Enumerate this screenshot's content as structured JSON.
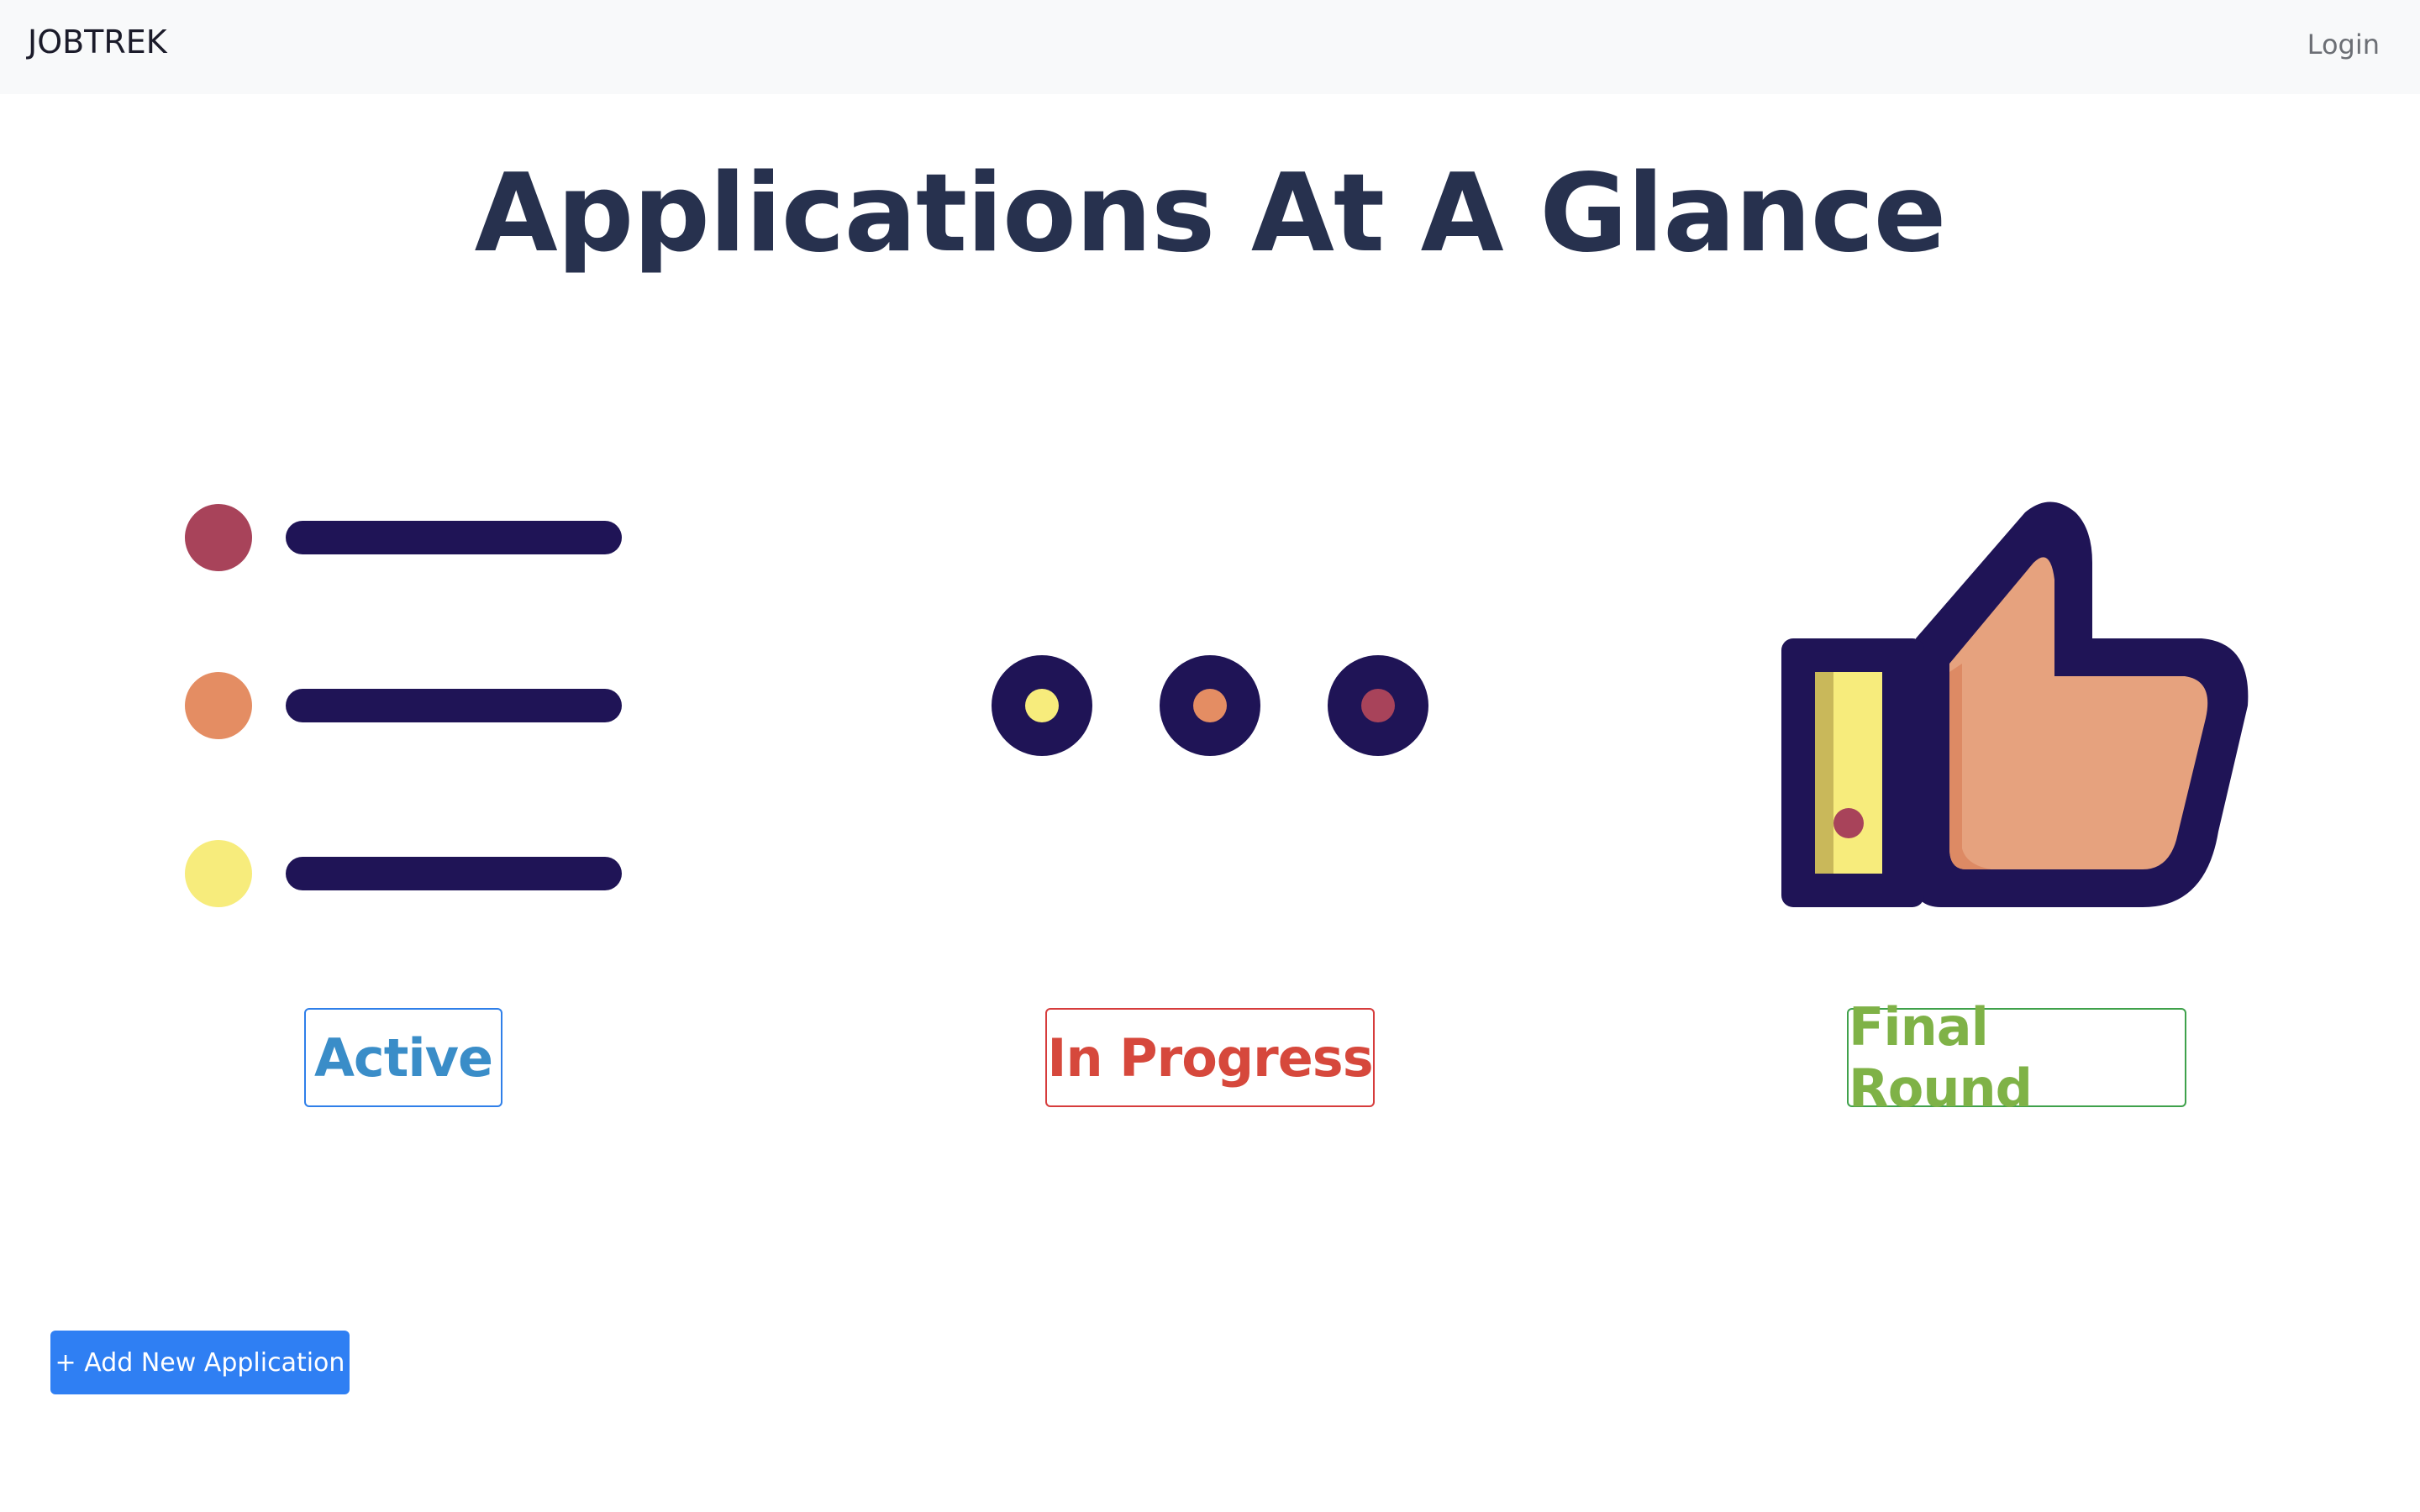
{
  "navbar": {
    "brand": "JOBTREK",
    "login_label": "Login"
  },
  "main": {
    "title": "Applications At A Glance",
    "categories": [
      {
        "label": "Active",
        "icon": "list-icon",
        "color": "#3a8dc8"
      },
      {
        "label": "In Progress",
        "icon": "ellipsis-dots-icon",
        "color": "#d6483c"
      },
      {
        "label": "Final Round",
        "icon": "thumbs-up-icon",
        "color": "#7fb247"
      }
    ],
    "add_button_label": "+ Add New Application"
  },
  "colors": {
    "navy": "#1f1456",
    "crimson": "#a8435a",
    "orange": "#e48d63",
    "yellow": "#f7ec7c",
    "skin": "#e6a27e",
    "primary": "#2f7ff3"
  }
}
